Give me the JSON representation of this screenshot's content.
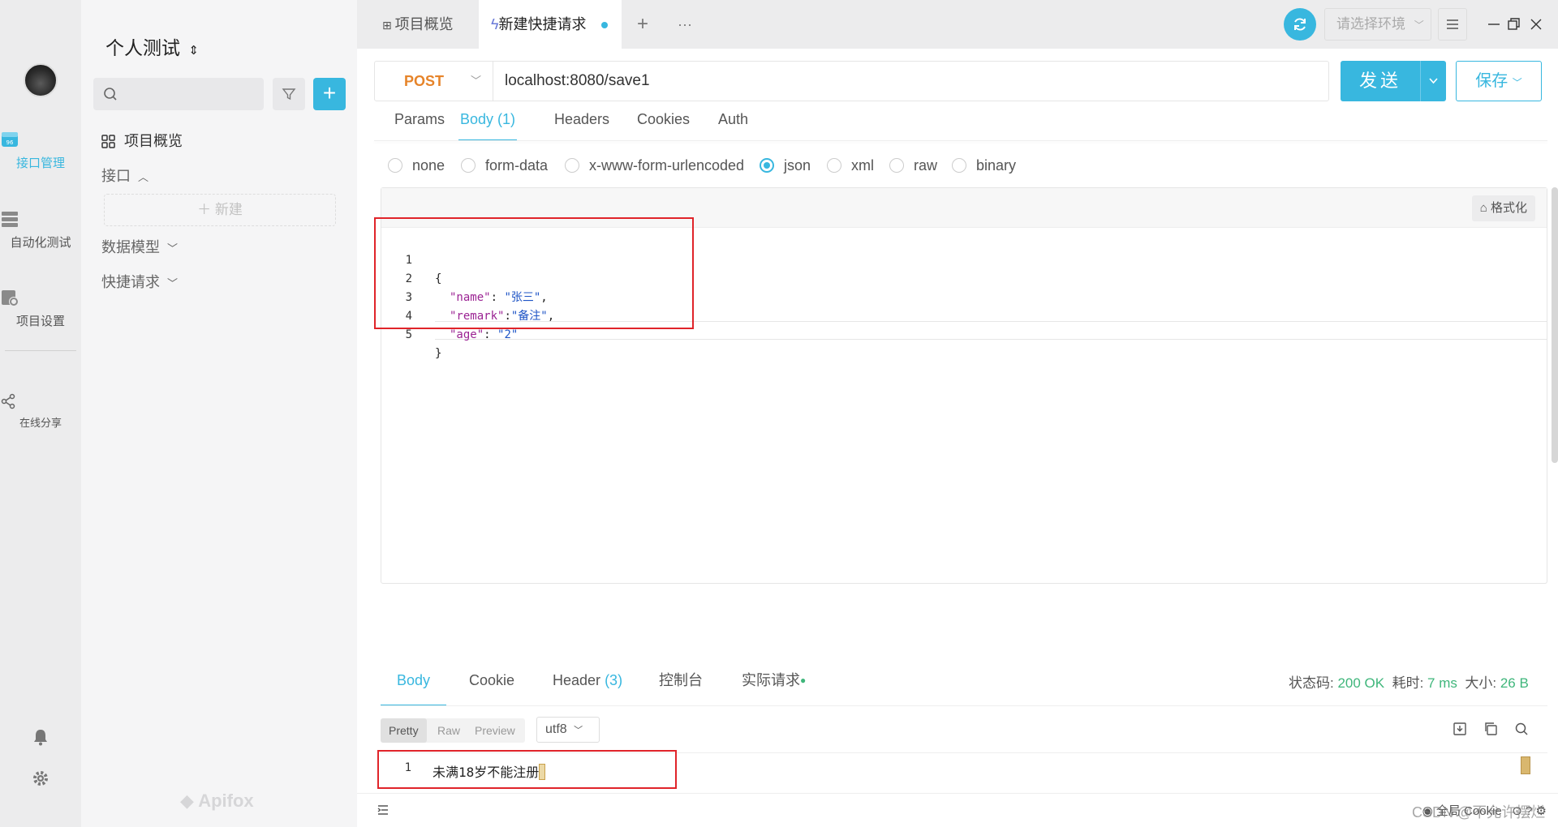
{
  "rail": {
    "items": [
      {
        "label": "接口管理",
        "icon": "api-management-icon",
        "active": true
      },
      {
        "label": "自动化测试",
        "icon": "automation-icon",
        "active": false
      },
      {
        "label": "项目设置",
        "icon": "project-settings-icon",
        "active": false
      },
      {
        "label": "在线分享",
        "icon": "share-icon",
        "active": false
      }
    ]
  },
  "sidebar": {
    "project_title": "个人测试",
    "overview": "项目概览",
    "interfaces": "接口",
    "new_label": "新建",
    "data_models": "数据模型",
    "quick_requests": "快捷请求",
    "brand": "Apifox"
  },
  "tabs": [
    {
      "label": "项目概览",
      "active": false
    },
    {
      "label": "新建快捷请求",
      "active": true
    }
  ],
  "env": {
    "placeholder": "请选择环境"
  },
  "request": {
    "method": "POST",
    "url": "localhost:8080/save1",
    "send_label": "发送",
    "save_label": "保存",
    "tabs": [
      "Params",
      "Body (1)",
      "Headers",
      "Cookies",
      "Auth"
    ],
    "active_tab": "Body (1)",
    "body_types": [
      "none",
      "form-data",
      "x-www-form-urlencoded",
      "json",
      "xml",
      "raw",
      "binary"
    ],
    "selected_body_type": "json",
    "format_label": "格式化",
    "body_lines": [
      {
        "n": "1",
        "t": "{"
      },
      {
        "n": "2",
        "key": "\"name\"",
        "sep": ": ",
        "val": "\"张三\"",
        "end": ","
      },
      {
        "n": "3",
        "key": "\"remark\"",
        "sep": ":",
        "val": "\"备注\"",
        "end": ","
      },
      {
        "n": "4",
        "key": "\"age\"",
        "sep": ": ",
        "val": "\"2\"",
        "end": ""
      },
      {
        "n": "5",
        "t": "}"
      }
    ]
  },
  "response": {
    "tabs": [
      "Body",
      "Cookie",
      "Header",
      "控制台",
      "实际请求"
    ],
    "header_count": "(3)",
    "status_label": "状态码:",
    "status_value": "200 OK",
    "time_label": "耗时:",
    "time_value": "7 ms",
    "size_label": "大小:",
    "size_value": "26 B",
    "views": [
      "Pretty",
      "Raw",
      "Preview"
    ],
    "encoding": "utf8",
    "line_number": "1",
    "body_text": "未满18岁不能注册"
  },
  "statusbar": {
    "cookie_label": "全局 Cookie"
  },
  "watermark": "CSDN @不允许摆烂",
  "colors": {
    "accent": "#38b7df",
    "method": "#e6842a",
    "success": "#3fb67b",
    "highlight_box": "#e0242a"
  }
}
